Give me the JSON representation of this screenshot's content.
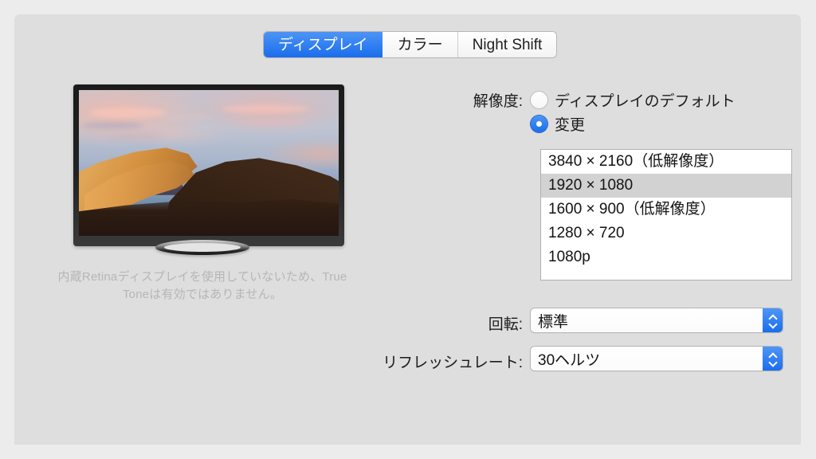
{
  "window": {
    "tabs": [
      {
        "label": "ディスプレイ",
        "selected": true
      },
      {
        "label": "カラー",
        "selected": false
      },
      {
        "label": "Night Shift",
        "selected": false
      }
    ]
  },
  "preview": {
    "caption": "内蔵Retinaディスプレイを使用していないため、True Toneは有効ではありません。",
    "wallpaper_name": "mojave-dune-wallpaper",
    "device_name": "external-display-mockup"
  },
  "controls": {
    "resolution": {
      "label": "解像度:",
      "options": [
        {
          "label": "ディスプレイのデフォルト",
          "selected": false
        },
        {
          "label": "変更",
          "selected": true
        }
      ],
      "list": [
        {
          "label": "3840 × 2160（低解像度）",
          "selected": false
        },
        {
          "label": "1920 × 1080",
          "selected": true
        },
        {
          "label": "1600 × 900（低解像度）",
          "selected": false
        },
        {
          "label": "1280 × 720",
          "selected": false
        },
        {
          "label": "1080p",
          "selected": false
        }
      ]
    },
    "rotation": {
      "label": "回転:",
      "value": "標準"
    },
    "refresh_rate": {
      "label": "リフレッシュレート:",
      "value": "30ヘルツ"
    }
  },
  "colors": {
    "accent": "#1a6ded",
    "panel_bg": "#dedede",
    "desktop_bg": "#ececec",
    "list_bg": "#ffffff",
    "list_selected_bg": "#d2d2d2",
    "caption_text": "#b6b6b6"
  }
}
